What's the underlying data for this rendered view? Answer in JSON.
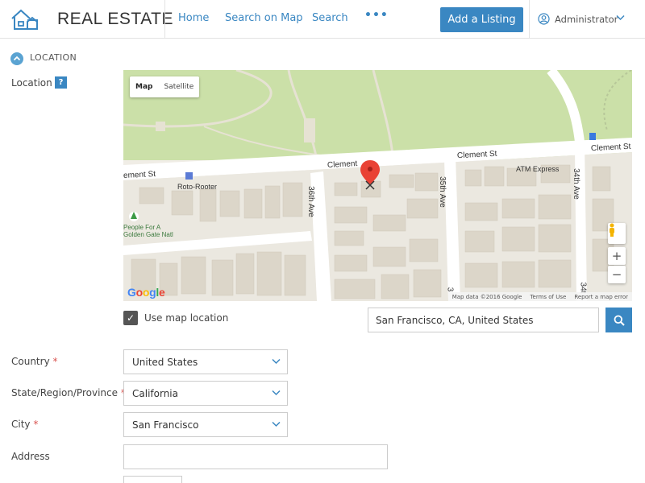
{
  "header": {
    "brand": "REAL ESTATE",
    "nav": [
      "Home",
      "Search on Map",
      "Search"
    ],
    "more": "•••",
    "add_listing": "Add a Listing",
    "user": "Administrator",
    "accent": "#3a87c2"
  },
  "section": {
    "title": "LOCATION"
  },
  "location": {
    "label": "Location",
    "help": "?",
    "map": {
      "type_options": [
        "Map",
        "Satellite"
      ],
      "selected_type": "Map",
      "zoom_in": "+",
      "zoom_out": "−",
      "logo": "Google",
      "footer": [
        "Map data ©2016 Google",
        "Terms of Use",
        "Report a map error"
      ],
      "streets": [
        "Clement St",
        "Clement",
        "Clement St",
        "ement St",
        "Clement St",
        "36th Ave",
        "35th Ave",
        "34th Ave",
        "Roto-Rooter",
        "ATM Express",
        "People For A",
        "Golden Gate Natl",
        "34",
        "34t",
        "3"
      ]
    },
    "use_map_location": "Use map location",
    "use_map_location_checked": true,
    "search_value": "San Francisco, CA, United States"
  },
  "fields": {
    "country": {
      "label": "Country",
      "required": "*",
      "value": "United States"
    },
    "state": {
      "label": "State/Region/Province",
      "required": "*",
      "value": "California"
    },
    "city": {
      "label": "City",
      "required": "*",
      "value": "San Francisco"
    },
    "address": {
      "label": "Address",
      "value": ""
    }
  }
}
